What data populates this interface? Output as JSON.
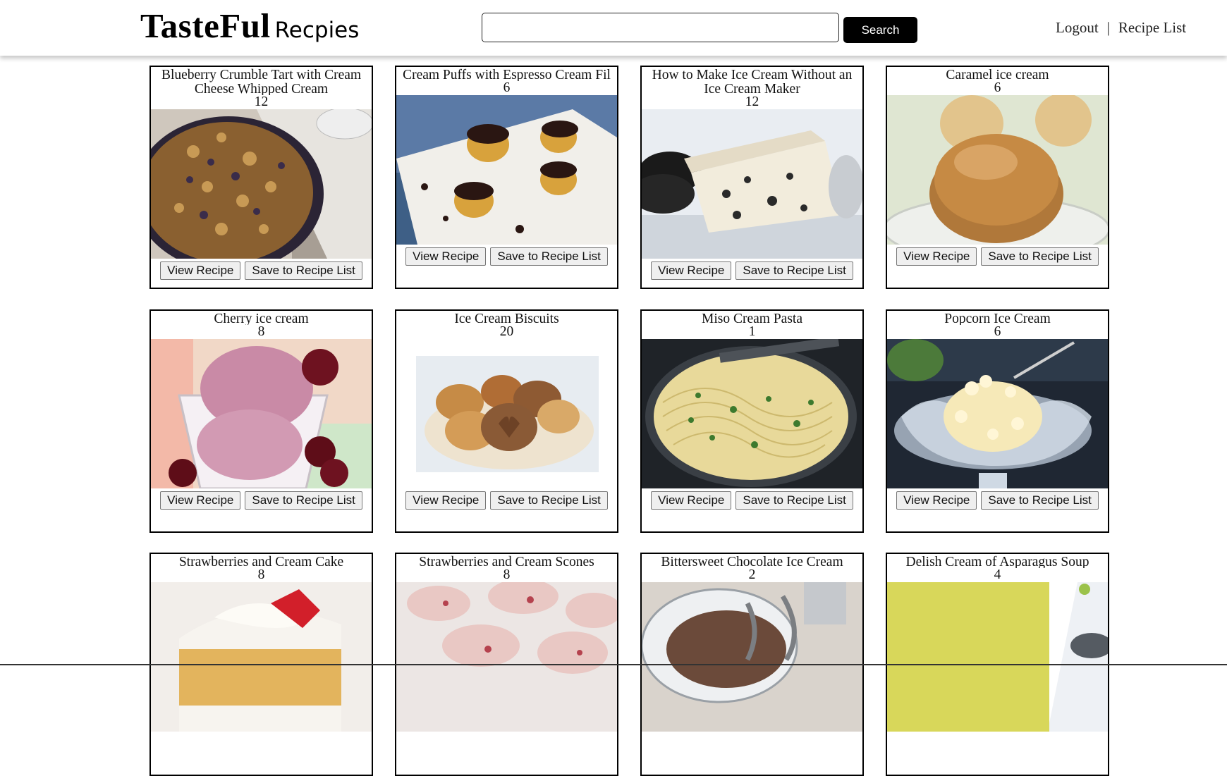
{
  "header": {
    "logo_main": "TasteFul",
    "logo_sub": "Recpies",
    "search_placeholder": "",
    "search_value": "",
    "search_label": "Search",
    "nav": {
      "logout": "Logout",
      "separator": "|",
      "recipe_list": "Recipe List"
    }
  },
  "card_buttons": {
    "view": "View Recipe",
    "save": "Save to Recipe List"
  },
  "recipes": [
    {
      "title": "Blueberry Crumble Tart with Cream\nCheese Whipped Cream",
      "count": "12",
      "image": "blueberry-crumble-tart"
    },
    {
      "title": "Cream Puffs with Espresso Cream Fil",
      "count": "6",
      "image": "cream-puffs"
    },
    {
      "title": "How to Make Ice Cream Without an\nIce Cream Maker",
      "count": "12",
      "image": "cookies-cream-ice-cream"
    },
    {
      "title": "Caramel ice cream",
      "count": "6",
      "image": "caramel-ice-cream"
    },
    {
      "title": "Cherry ice cream",
      "count": "8",
      "image": "cherry-ice-cream"
    },
    {
      "title": "Ice Cream Biscuits",
      "count": "20",
      "image": "ice-cream-biscuits"
    },
    {
      "title": "Miso Cream Pasta",
      "count": "1",
      "image": "miso-cream-pasta"
    },
    {
      "title": "Popcorn Ice Cream",
      "count": "6",
      "image": "popcorn-ice-cream"
    },
    {
      "title": "Strawberries and Cream Cake",
      "count": "8",
      "image": "strawberry-cream-cake"
    },
    {
      "title": "Strawberries and Cream Scones",
      "count": "8",
      "image": "strawberry-scones"
    },
    {
      "title": "Bittersweet Chocolate Ice Cream",
      "count": "2",
      "image": "chocolate-ice-cream"
    },
    {
      "title": "Delish Cream of Asparagus Soup",
      "count": "4",
      "image": "asparagus-soup"
    }
  ]
}
